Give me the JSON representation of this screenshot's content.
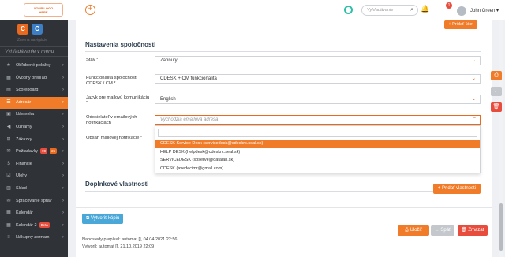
{
  "topbar": {
    "logo_line1": "YOUR LOGO",
    "logo_line2": "HERE",
    "search_placeholder": "Vyhľadávanie",
    "notification_count": "1",
    "user_name": "John Green"
  },
  "sidebar": {
    "sub_label": "Zmena navigácie",
    "search_placeholder": "Vyhľadávanie v menu",
    "items": [
      {
        "label": "Obľúbené položky",
        "icon": "star-icon"
      },
      {
        "label": "Úvodný prehľad",
        "icon": "dashboard-icon"
      },
      {
        "label": "Scoreboard",
        "icon": "scoreboard-icon"
      },
      {
        "label": "Adresár",
        "icon": "address-book-icon"
      },
      {
        "label": "Nástenka",
        "icon": "board-icon"
      },
      {
        "label": "Oznamy",
        "icon": "megaphone-icon"
      },
      {
        "label": "Zákazky",
        "icon": "cart-icon"
      },
      {
        "label": "Požiadavky",
        "icon": "ticket-icon",
        "badge1": "99",
        "badge2": "25"
      },
      {
        "label": "Financie",
        "icon": "money-icon"
      },
      {
        "label": "Úlohy",
        "icon": "tasks-icon"
      },
      {
        "label": "Sklad",
        "icon": "warehouse-icon"
      },
      {
        "label": "Spracovanie správ",
        "icon": "mail-icon"
      },
      {
        "label": "Kalendár",
        "icon": "calendar-icon"
      },
      {
        "label": "Kalendár 2",
        "icon": "calendar-icon",
        "badge1": "Beta"
      },
      {
        "label": "Nákupný zoznam",
        "icon": "list-icon"
      }
    ]
  },
  "main": {
    "top_button": "+ Pridať účet",
    "section_title": "Nastavenia spoločnosti",
    "fields": [
      {
        "label": "Stav",
        "value": "Zapnutý"
      },
      {
        "label": "Funkcionalita spoločnosti CDESK / CM",
        "value": "CDESK + CM funkcionalita"
      },
      {
        "label": "Jazyk pre mailovú komunikáciu",
        "value": "English"
      },
      {
        "label": "Odosielateľ v emailových notifikáciách",
        "value": "Východzia emailová adresa"
      },
      {
        "label": "Obsah mailovej notifikácie",
        "value": ""
      }
    ],
    "dropdown_options": [
      "CDESK Service Desk (servicedesk@cdeskrc.seal.sk)",
      "HELP DESK (helpdesk@cdeskrc.seal.sk)",
      "SERVICEDESK (spserve@datalan.sk)",
      "CDESK (avedecimr@gmail.com)"
    ],
    "section2_title": "Doplnkové vlastnosti",
    "add_property_button": "+ Pridať vlastnosti",
    "copy_button": "Vytvoriť kópiu",
    "last_modified": "Naposledy prepísal: automat  [], 04.04.2021 22:56",
    "created": "Vytvoril: automat  [], 21.10.2019 22:09",
    "save_button": "Uložiť",
    "back_button": "Späť",
    "delete_button": "Zmazať"
  },
  "colors": {
    "accent": "#f07c2a",
    "sidebar_bg": "#2f3237",
    "copy": "#4aa8d8",
    "danger": "#e74c3c"
  }
}
